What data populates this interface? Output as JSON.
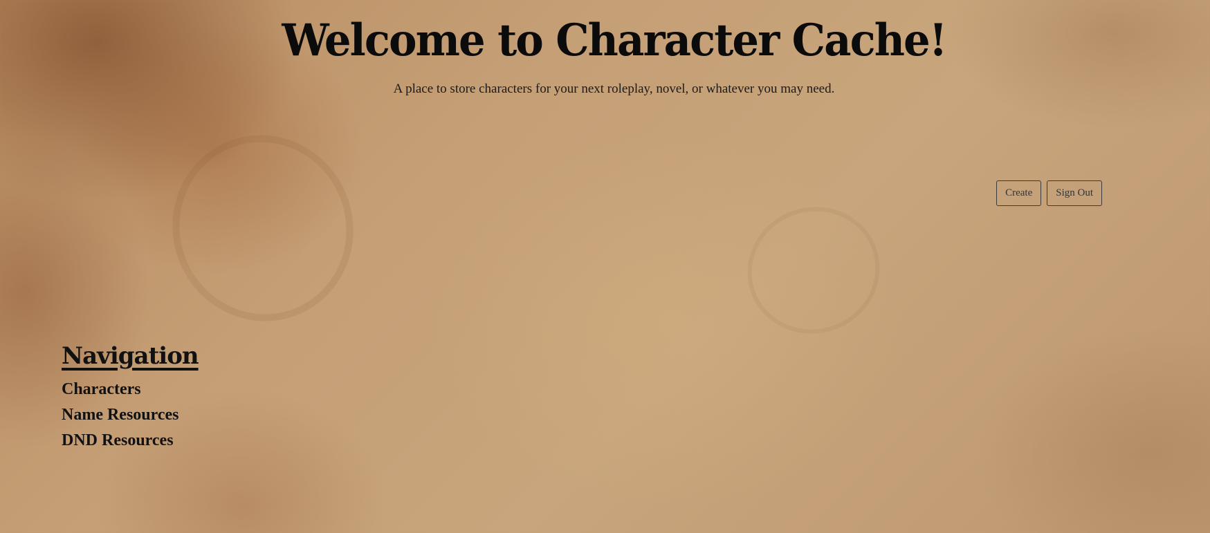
{
  "header": {
    "title": "Welcome to Character Cache!",
    "subtitle": "A place to store characters for your next roleplay, novel, or whatever you may need."
  },
  "actions": {
    "create_label": "Create",
    "sign_out_label": "Sign Out"
  },
  "navigation": {
    "heading": "Navigation",
    "items": [
      {
        "label": "Characters"
      },
      {
        "label": "Name Resources"
      },
      {
        "label": "DND Resources"
      }
    ]
  },
  "colors": {
    "text": "#111111",
    "background": "#c59f76",
    "button_border": "#3a3a3a"
  }
}
